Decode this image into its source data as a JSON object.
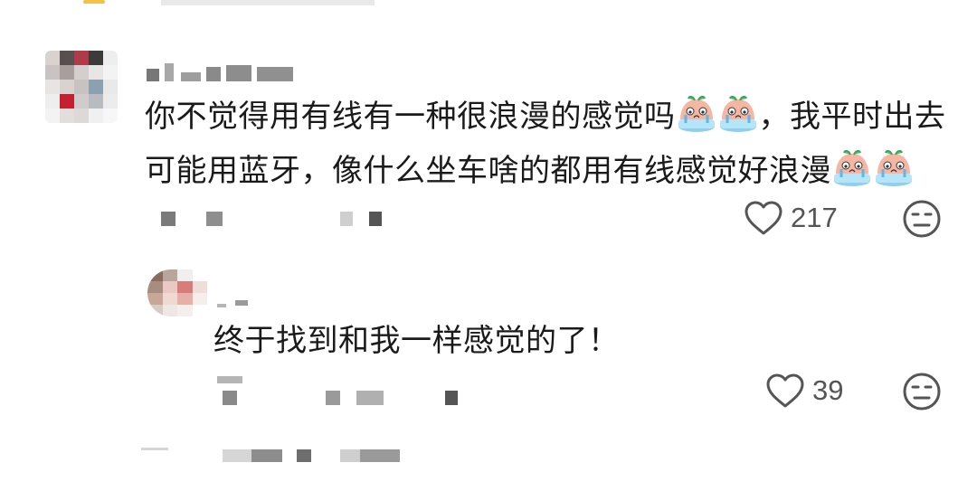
{
  "comment": {
    "username": "",
    "text_lines": [
      [
        "你不觉得用有线有一种很浪漫的感觉吗",
        "crying-emoji",
        "crying-emoji",
        "，我平时出去"
      ],
      [
        "可能用蓝牙，像什么坐车啥的都用有线感觉好浪漫",
        "crying-emoji",
        "crying-emoji"
      ]
    ],
    "like_count": "217",
    "icons": {
      "like": "heart-icon",
      "dislike": "unhappy-face-icon"
    }
  },
  "reply": {
    "username": "",
    "text": "终于找到和我一样感觉的了！",
    "like_count": "39",
    "icons": {
      "like": "heart-icon",
      "dislike": "unhappy-face-icon"
    }
  },
  "colors": {
    "text": "#1a1a1a",
    "muted": "#555555",
    "placeholder": "#c8c8c8"
  }
}
